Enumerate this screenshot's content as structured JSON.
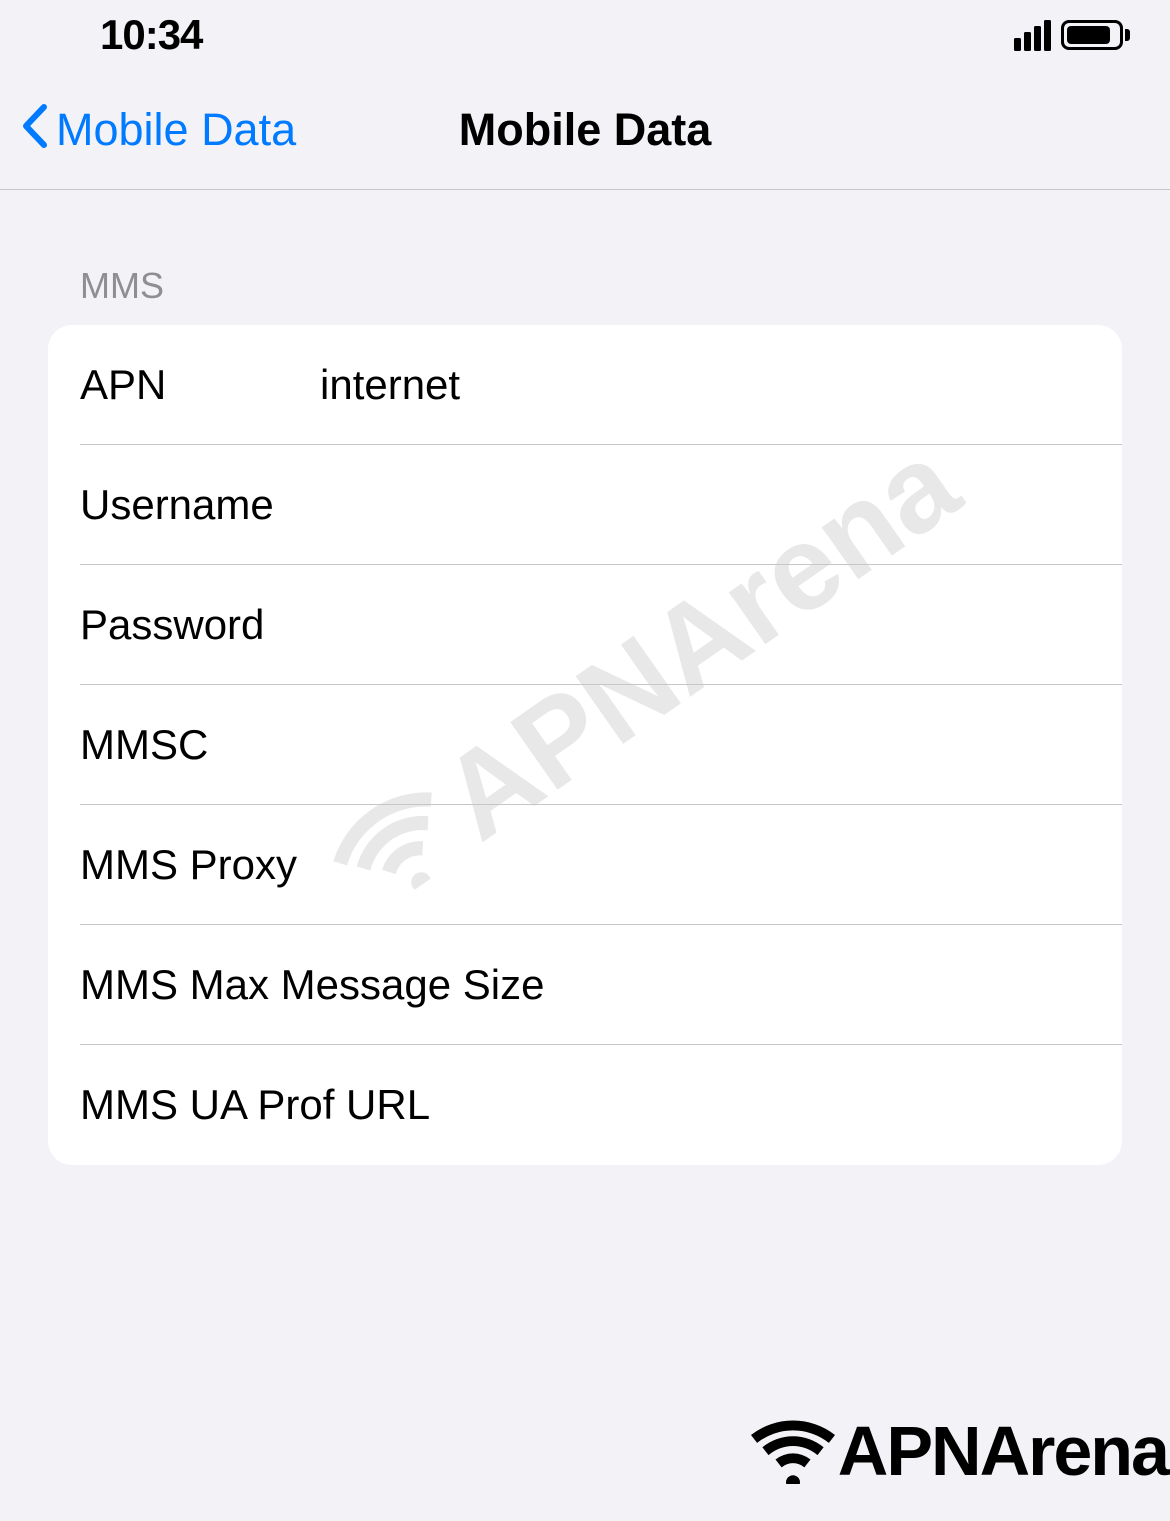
{
  "status_bar": {
    "time": "10:34"
  },
  "nav": {
    "back_label": "Mobile Data",
    "title": "Mobile Data"
  },
  "section": {
    "header": "MMS",
    "rows": [
      {
        "label": "APN",
        "value": "internet"
      },
      {
        "label": "Username",
        "value": ""
      },
      {
        "label": "Password",
        "value": ""
      },
      {
        "label": "MMSC",
        "value": ""
      },
      {
        "label": "MMS Proxy",
        "value": ""
      },
      {
        "label": "MMS Max Message Size",
        "value": ""
      },
      {
        "label": "MMS UA Prof URL",
        "value": ""
      }
    ]
  },
  "watermark": {
    "text": "APNArena"
  },
  "logo": {
    "text": "APNArena"
  }
}
